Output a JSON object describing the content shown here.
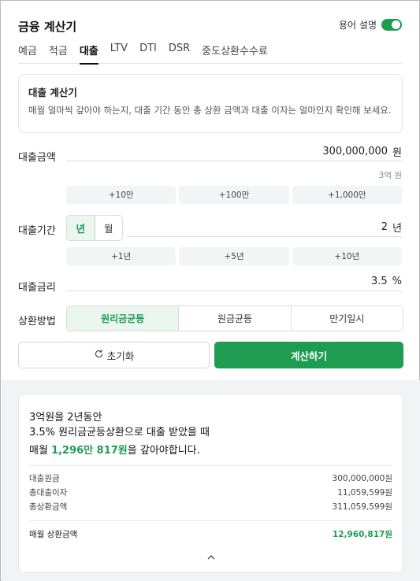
{
  "header": {
    "title": "금융 계산기",
    "glossary_label": "용어 설명",
    "glossary_on": true
  },
  "tabs": [
    "예금",
    "적금",
    "대출",
    "LTV",
    "DTI",
    "DSR",
    "중도상환수수료"
  ],
  "active_tab": "대출",
  "info": {
    "title": "대출 계산기",
    "desc": "매월 얼마씩 갚아야 하는지, 대출 기간 동안 총 상환 금액과 대출 이자는 얼마인지 확인해 보세요."
  },
  "loan_amount": {
    "label": "대출금액",
    "value": "300,000,000",
    "unit": "원",
    "hint": "3억 원",
    "quick": [
      "+10만",
      "+100만",
      "+1,000만"
    ]
  },
  "loan_period": {
    "label": "대출기간",
    "unit_options": [
      "년",
      "월"
    ],
    "selected_unit": "년",
    "value": "2",
    "unit": "년",
    "quick": [
      "+1년",
      "+5년",
      "+10년"
    ]
  },
  "interest": {
    "label": "대출금리",
    "value": "3.5",
    "unit": "%"
  },
  "repayment": {
    "label": "상환방법",
    "options": [
      "원리금균등",
      "원금균등",
      "만기일시"
    ],
    "selected": "원리금균등"
  },
  "actions": {
    "reset_label": "초기화",
    "calc_label": "계산하기"
  },
  "result": {
    "line1": "3억원을 2년동안",
    "line2": "3.5% 원리금균등상환으로 대출 받았을 때",
    "line3_prefix": "매월 ",
    "line3_amount": "1,296만 817원",
    "line3_suffix": "을 갚아야합니다.",
    "details": [
      {
        "label": "대출원금",
        "value": "300,000,000원"
      },
      {
        "label": "총대출이자",
        "value": "11,059,599원"
      },
      {
        "label": "총상환금액",
        "value": "311,059,599원"
      }
    ],
    "monthly_label": "매월 상환금액",
    "monthly_value": "12,960,817원"
  },
  "colors": {
    "accent": "#1e9c52",
    "accent_bg": "#eaf6ef"
  }
}
